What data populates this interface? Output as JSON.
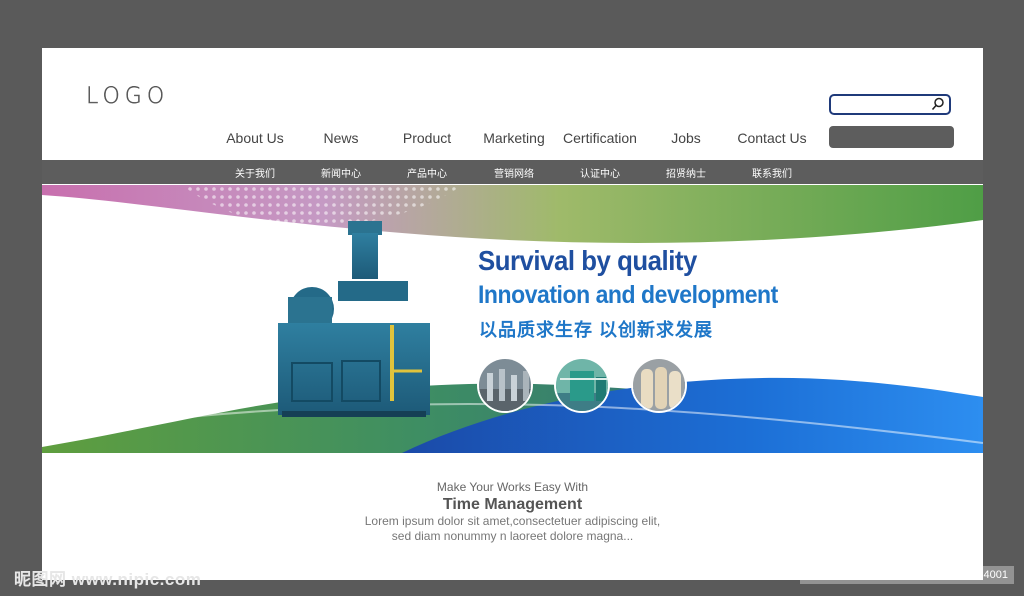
{
  "header": {
    "logo_text": "LOGO",
    "search_placeholder": ""
  },
  "nav": {
    "items": [
      {
        "label": "About Us"
      },
      {
        "label": "News"
      },
      {
        "label": "Product"
      },
      {
        "label": "Marketing"
      },
      {
        "label": "Certification"
      },
      {
        "label": "Jobs"
      },
      {
        "label": "Contact Us"
      }
    ]
  },
  "subnav": {
    "items": [
      {
        "label": "关于我们"
      },
      {
        "label": "新闻中心"
      },
      {
        "label": "产品中心"
      },
      {
        "label": "营销网络"
      },
      {
        "label": "认证中心"
      },
      {
        "label": "招贤纳士"
      },
      {
        "label": "联系我们"
      }
    ]
  },
  "banner": {
    "slogan_line1": "Survival by quality",
    "slogan_line2": "Innovation and development",
    "slogan_line3": "以品质求生存  以创新求发展"
  },
  "intro": {
    "subtitle": "Make Your Works Easy With",
    "title": "Time Management",
    "text_line1": "Lorem ipsum dolor sit amet,consectetuer adipiscing elit,",
    "text_line2": "sed diam nonummy n laoreet dolore magna..."
  },
  "watermark": {
    "left": "昵图网 www.nipic.com",
    "right": "ID:8051772 NO:20210106132450254001"
  },
  "colors": {
    "background": "#5a5a5a",
    "nav_bar": "#5d5d5d",
    "accent_dark_blue": "#1f4fa0",
    "accent_blue": "#1f77c8",
    "search_border": "#1f3a7a"
  }
}
